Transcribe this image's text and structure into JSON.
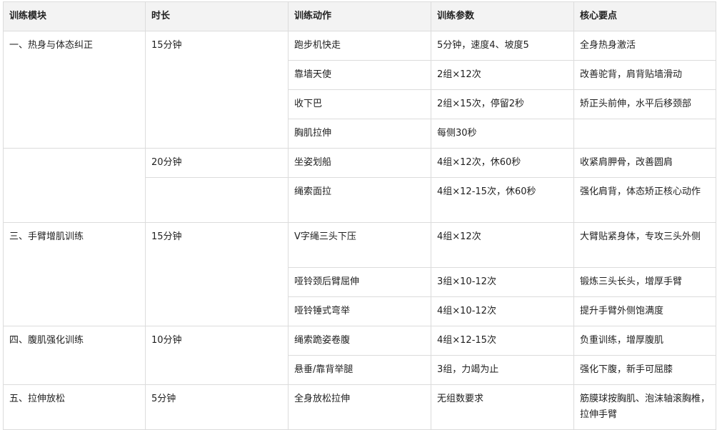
{
  "table": {
    "headers": [
      "训练模块",
      "时长",
      "训练动作",
      "训练参数",
      "核心要点"
    ],
    "rows": [
      {
        "module": "一、热身与体态纠正",
        "duration": "15分钟",
        "action": "跑步机快走",
        "params": "5分钟，速度4、坡度5",
        "points": "全身热身激活"
      },
      {
        "action": "靠墙天使",
        "params": "2组×12次",
        "points": "改善驼背，肩背贴墙滑动"
      },
      {
        "action": "收下巴",
        "params": "2组×15次，停留2秒",
        "points": "矫正头前伸，水平后移颈部"
      },
      {
        "action": "胸肌拉伸",
        "params": "每侧30秒",
        "points": ""
      },
      {
        "module": "",
        "duration": "20分钟",
        "action": "坐姿划船",
        "params": "4组×12次，休60秒",
        "points": "收紧肩胛骨，改善圆肩"
      },
      {
        "duration": "",
        "action": "绳索面拉",
        "params": "4组×12-15次，休60秒",
        "points": "强化肩背，体态矫正核心动作"
      },
      {
        "module": "三、手臂增肌训练",
        "duration": "15分钟",
        "action": "V字绳三头下压",
        "params": "4组×12次",
        "points": "大臂贴紧身体，专攻三头外侧"
      },
      {
        "action": "哑铃颈后臂屈伸",
        "params": "3组×10-12次",
        "points": "锻炼三头长头，增厚手臂"
      },
      {
        "action": "哑铃锤式弯举",
        "params": "4组×10-12次",
        "points": "提升手臂外侧饱满度"
      },
      {
        "module": "四、腹肌强化训练",
        "duration": "10分钟",
        "action": "绳索跪姿卷腹",
        "params": "4组×12-15次",
        "points": "负重训练，增厚腹肌"
      },
      {
        "action": "悬垂/靠背举腿",
        "params": "3组，力竭为止",
        "points": "强化下腹，新手可屈膝"
      },
      {
        "module": "五、拉伸放松",
        "duration": "5分钟",
        "action": "全身放松拉伸",
        "params": "无组数要求",
        "points": "筋膜球按胸肌、泡沫轴滚胸椎，拉伸手臂"
      }
    ]
  }
}
